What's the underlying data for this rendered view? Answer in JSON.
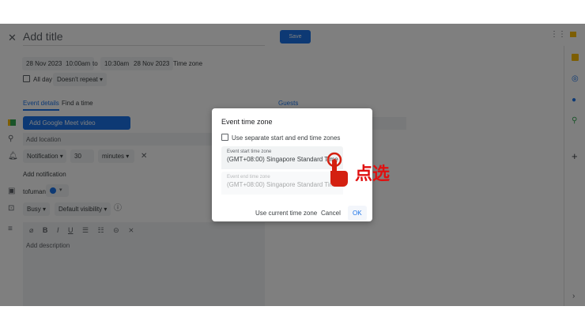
{
  "header": {
    "title_placeholder": "Add title",
    "save": "Save"
  },
  "datetime": {
    "start_date": "28 Nov 2023",
    "start_time": "10:00am",
    "to": "to",
    "end_time": "10:30am",
    "end_date": "28 Nov 2023",
    "time_zone": "Time zone"
  },
  "allday": {
    "label": "All day",
    "repeat": "Doesn't repeat"
  },
  "tabs": [
    {
      "label": "Event details"
    },
    {
      "label": "Find a time"
    }
  ],
  "guests": "Guests",
  "meet_button": "Add Google Meet video conferencing",
  "location_placeholder": "Add location",
  "notification": {
    "type": "Notification",
    "value": "30",
    "unit": "minutes",
    "add": "Add notification"
  },
  "calendar": {
    "owner": "tofuman",
    "color": "#1a73e8"
  },
  "status": {
    "busy": "Busy",
    "visibility": "Default visibility"
  },
  "description_placeholder": "Add description",
  "dialog": {
    "title": "Event time zone",
    "checkbox_label": "Use separate start and end time zones",
    "start_label": "Event start time zone",
    "start_value": "(GMT+08:00) Singapore Standard Time",
    "end_label": "Event end time zone",
    "end_value": "(GMT+08:00) Singapore Standard Time",
    "use_current": "Use current time zone",
    "cancel": "Cancel",
    "ok": "OK"
  },
  "annotation": "点选",
  "colors": {
    "accent": "#1a73e8",
    "annotation": "#e01010"
  }
}
